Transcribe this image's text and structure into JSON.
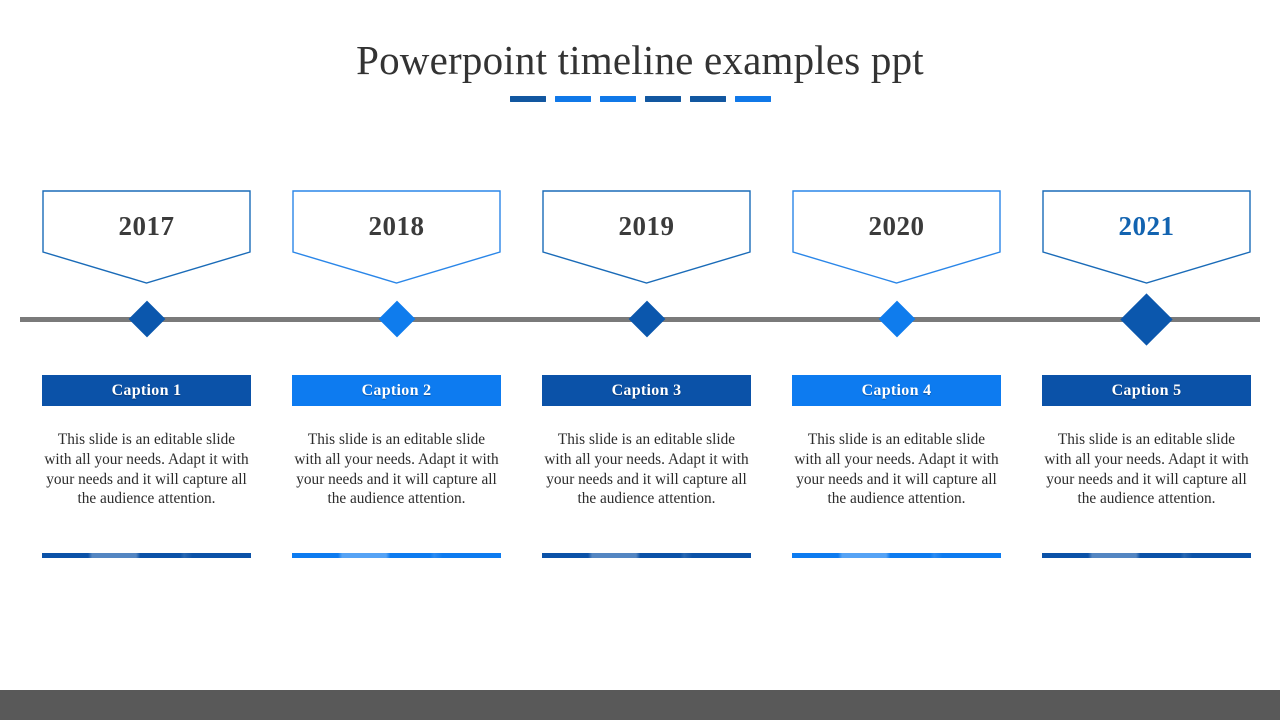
{
  "slide": {
    "title": "Powerpoint timeline examples ppt",
    "background_color": "#ffffff",
    "accent_dark": "#0b52a8",
    "accent_bright": "#0d7bf0",
    "timeline_color": "#7a7a7a",
    "footer_color": "#595959"
  },
  "title_dashes": [
    {
      "color": "#1257a0"
    },
    {
      "color": "#1078e8"
    },
    {
      "color": "#1078e8"
    },
    {
      "color": "#1257a0"
    },
    {
      "color": "#1257a0"
    },
    {
      "color": "#1078e8"
    }
  ],
  "body_paragraph": "This slide is an editable slide with all your needs. Adapt it with your needs and it will capture all the audience attention.",
  "milestones": [
    {
      "year": "2017",
      "caption": "Caption 1",
      "description": "This slide is an editable slide with all your needs. Adapt it with your needs and it will capture all the audience attention.",
      "caption_color": "#0b52a8",
      "border_color": "#1a6bb8",
      "diamond_color": "#0b57ad",
      "year_color": "#3b3b3b",
      "marker_size": "small",
      "highlighted": false
    },
    {
      "year": "2018",
      "caption": "Caption 2",
      "description": "This slide is an editable slide with all your needs. Adapt it with your needs and it will capture all the audience attention.",
      "caption_color": "#0d7bf0",
      "border_color": "#2a86e8",
      "diamond_color": "#0f7ced",
      "year_color": "#3b3b3b",
      "marker_size": "small",
      "highlighted": false
    },
    {
      "year": "2019",
      "caption": "Caption 3",
      "description": "This slide is an editable slide with all your needs. Adapt it with your needs and it will capture all the audience attention.",
      "caption_color": "#0b52a8",
      "border_color": "#1a6bb8",
      "diamond_color": "#0b57ad",
      "year_color": "#3b3b3b",
      "marker_size": "small",
      "highlighted": false
    },
    {
      "year": "2020",
      "caption": "Caption 4",
      "description": "This slide is an editable slide with all your needs. Adapt it with your needs and it will capture all the audience attention.",
      "caption_color": "#0d7bf0",
      "border_color": "#2a86e8",
      "diamond_color": "#0f7ced",
      "year_color": "#3b3b3b",
      "marker_size": "small",
      "highlighted": false
    },
    {
      "year": "2021",
      "caption": "Caption 5",
      "description": "This slide is an editable slide with all your needs. Adapt it with your needs and it will capture all the audience attention.",
      "caption_color": "#0b52a8",
      "border_color": "#1a6bb8",
      "diamond_color": "#0b57ad",
      "year_color": "#1263b0",
      "marker_size": "large",
      "highlighted": true
    }
  ]
}
